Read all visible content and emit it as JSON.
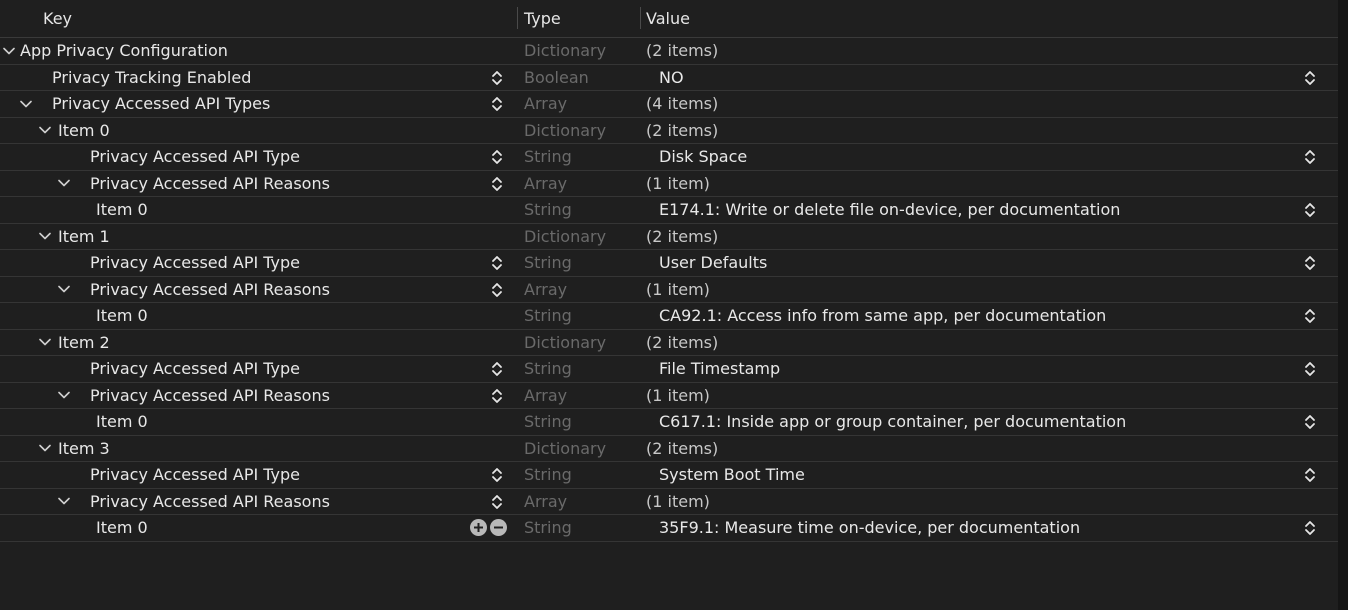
{
  "header": {
    "key_label": "Key",
    "type_label": "Type",
    "value_label": "Value"
  },
  "icons": {
    "disclosure": "chevron-down-icon",
    "stepper": "up-down-stepper-icon",
    "add": "plus-circle-icon",
    "remove": "minus-circle-icon"
  },
  "colors": {
    "background": "#1f1f1f",
    "text": "#e8e8e8",
    "type_text": "#6a6a6a",
    "grid_line": "#353535"
  },
  "rows": [
    {
      "key": "App Privacy Configuration",
      "type": "Dictionary",
      "value": "(2 items)",
      "depth": 0,
      "expandable": true,
      "is_count": true
    },
    {
      "key": "Privacy Tracking Enabled",
      "type": "Boolean",
      "value": "NO",
      "depth": 1,
      "expandable": false,
      "key_stepper": true,
      "value_stepper": true
    },
    {
      "key": "Privacy Accessed API Types",
      "type": "Array",
      "value": "(4 items)",
      "depth": 1,
      "expandable": true,
      "key_stepper": true,
      "is_count": true
    },
    {
      "key": "Item 0",
      "type": "Dictionary",
      "value": "(2 items)",
      "depth": 2,
      "expandable": true,
      "is_count": true
    },
    {
      "key": "Privacy Accessed API Type",
      "type": "String",
      "value": "Disk Space",
      "depth": 3,
      "expandable": false,
      "key_stepper": true,
      "value_stepper": true
    },
    {
      "key": "Privacy Accessed API Reasons",
      "type": "Array",
      "value": "(1 item)",
      "depth": 3,
      "expandable": true,
      "key_stepper": true,
      "is_count": true
    },
    {
      "key": "Item 0",
      "type": "String",
      "value": "E174.1: Write or delete file on-device, per documentation",
      "depth": 4,
      "expandable": false,
      "value_stepper": true
    },
    {
      "key": "Item 1",
      "type": "Dictionary",
      "value": "(2 items)",
      "depth": 2,
      "expandable": true,
      "is_count": true
    },
    {
      "key": "Privacy Accessed API Type",
      "type": "String",
      "value": "User Defaults",
      "depth": 3,
      "expandable": false,
      "key_stepper": true,
      "value_stepper": true
    },
    {
      "key": "Privacy Accessed API Reasons",
      "type": "Array",
      "value": "(1 item)",
      "depth": 3,
      "expandable": true,
      "key_stepper": true,
      "is_count": true
    },
    {
      "key": "Item 0",
      "type": "String",
      "value": "CA92.1: Access info from same app, per documentation",
      "depth": 4,
      "expandable": false,
      "value_stepper": true
    },
    {
      "key": "Item 2",
      "type": "Dictionary",
      "value": "(2 items)",
      "depth": 2,
      "expandable": true,
      "is_count": true
    },
    {
      "key": "Privacy Accessed API Type",
      "type": "String",
      "value": "File Timestamp",
      "depth": 3,
      "expandable": false,
      "key_stepper": true,
      "value_stepper": true
    },
    {
      "key": "Privacy Accessed API Reasons",
      "type": "Array",
      "value": "(1 item)",
      "depth": 3,
      "expandable": true,
      "key_stepper": true,
      "is_count": true
    },
    {
      "key": "Item 0",
      "type": "String",
      "value": "C617.1: Inside app or group container, per documentation",
      "depth": 4,
      "expandable": false,
      "value_stepper": true
    },
    {
      "key": "Item 3",
      "type": "Dictionary",
      "value": "(2 items)",
      "depth": 2,
      "expandable": true,
      "is_count": true
    },
    {
      "key": "Privacy Accessed API Type",
      "type": "String",
      "value": "System Boot Time",
      "depth": 3,
      "expandable": false,
      "key_stepper": true,
      "value_stepper": true
    },
    {
      "key": "Privacy Accessed API Reasons",
      "type": "Array",
      "value": "(1 item)",
      "depth": 3,
      "expandable": true,
      "key_stepper": true,
      "is_count": true
    },
    {
      "key": "Item 0",
      "type": "String",
      "value": "35F9.1: Measure time on-device, per documentation",
      "depth": 4,
      "expandable": false,
      "value_stepper": true,
      "add_remove": true
    }
  ]
}
